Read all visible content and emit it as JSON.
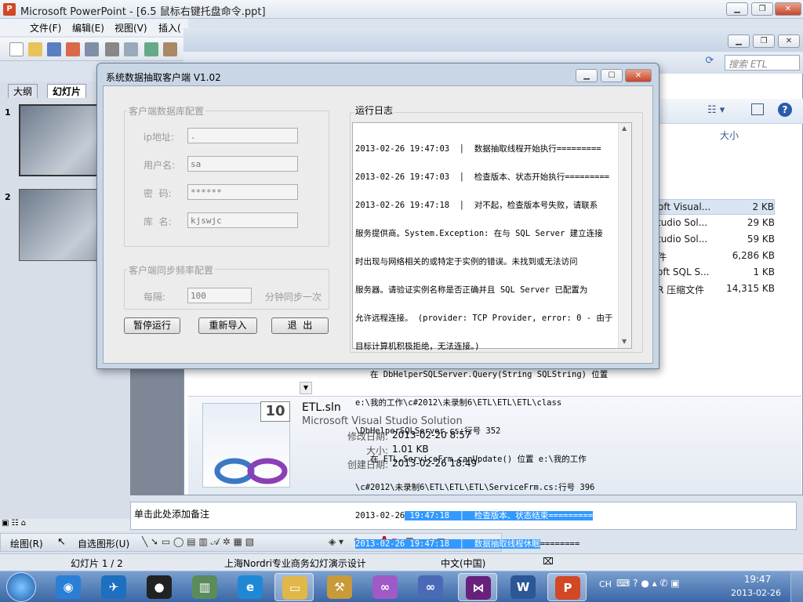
{
  "powerpoint": {
    "title": "Microsoft PowerPoint - [6.5 鼠标右键托盘命令.ppt]",
    "menu": [
      "文件(F)",
      "编辑(E)",
      "视图(V)",
      "插入("
    ],
    "tabs": [
      "大纲",
      "幻灯片"
    ],
    "slides": [
      "1",
      "2"
    ],
    "notes_placeholder": "单击此处添加备注",
    "draw_label": "绘图(R)",
    "autoshape_label": "自选图形(U)",
    "status": {
      "slide": "幻灯片 1 / 2",
      "design": "上海Nordri专业商务幻灯演示设计",
      "language": "中文(中国)"
    }
  },
  "explorer": {
    "search_placeholder": "搜索 ETL",
    "column_size": "大小",
    "files": [
      {
        "name": "oft Visual...",
        "size": "2 KB"
      },
      {
        "name": "tudio Sol...",
        "size": "29 KB"
      },
      {
        "name": "tudio Sol...",
        "size": "59 KB"
      },
      {
        "name": "件",
        "size": "6,286 KB"
      },
      {
        "name": "oft SQL S...",
        "size": "1 KB"
      },
      {
        "name": "R 压缩文件",
        "size": "14,315 KB"
      }
    ],
    "details": {
      "filename": "ETL.sln",
      "type": "Microsoft Visual Studio Solution",
      "modified_label": "修改日期:",
      "modified": "2013-02-20 8:57",
      "size_label": "大小:",
      "size": "1.01 KB",
      "created_label": "创建日期:",
      "created": "2013-02-26 18:49",
      "badge": "10"
    }
  },
  "dialog": {
    "title": "系统数据抽取客户端 V1.02",
    "db_group": "客户端数据库配置",
    "fields": [
      {
        "label": "ip地址:",
        "value": "."
      },
      {
        "label": "用户名:",
        "value": "sa"
      },
      {
        "label": "密  码:",
        "value": "******"
      },
      {
        "label": "库  名:",
        "value": "kjswjc"
      }
    ],
    "sync_group": "客户端同步频率配置",
    "interval_label": "每隔:",
    "interval_value": "100",
    "interval_suffix": "分钟同步一次",
    "buttons": {
      "pause": "暂停运行",
      "reimport": "重新导入",
      "exit": "退  出"
    },
    "log_title": "运行日志",
    "log_lines": [
      "2013-02-26 19:47:03  │  数据抽取线程开始执行=========",
      "2013-02-26 19:47:03  │  检查版本、状态开始执行=========",
      "2013-02-26 19:47:18  │  对不起，检查版本号失败，请联系",
      "服务提供商。System.Exception: 在与 SQL Server 建立连接",
      "时出现与网络相关的或特定于实例的错误。未找到或无法访问",
      "服务器。请验证实例名称是否正确并且 SQL Server 已配置为",
      "允许远程连接。 (provider: TCP Provider, error: 0 - 由于",
      "目标计算机积极拒绝，无法连接。)",
      "   在 DbHelperSQLServer.Query(String SQLString) 位置",
      "e:\\我的工作\\c#2012\\未录制6\\ETL\\ETL\\ETL\\class",
      "\\DbHelperSQLServer.cs:行号 352",
      "   在 ETL.ServiceFrm.canUpdate() 位置 e:\\我的工作",
      "\\c#2012\\未录制6\\ETL\\ETL\\ETL\\ServiceFrm.cs:行号 396"
    ],
    "log_sel_1_pre": "2013-02-26",
    "log_sel_1_hl": " 19:47:18  │  检查版本、状态结束=========",
    "log_sel_2_hl": "2013-02-26 19:47:18  │  数据抽取线程休眠",
    "log_sel_2_post": "========"
  },
  "taskbar": {
    "time": "19:47",
    "date": "2013-02-26",
    "ime": "CH",
    "apps": [
      "start",
      "media-player",
      "feiq",
      "qq",
      "setup",
      "ie",
      "explorer",
      "tool",
      "vs-solution",
      "vs-infinity",
      "visual-studio",
      "word",
      "powerpoint"
    ]
  }
}
